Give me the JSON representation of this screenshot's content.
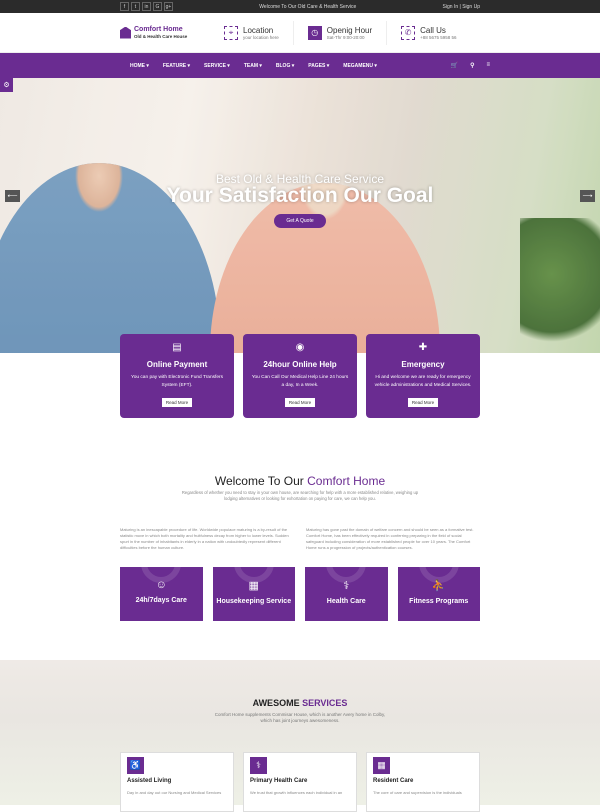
{
  "topbar": {
    "social": [
      "f",
      "t",
      "in",
      "G",
      "g+"
    ],
    "message": "Welcome To Our Old Care & Health Service",
    "signin": "Sign In",
    "signup": "Sign Up"
  },
  "header": {
    "logo_title": "Comfort Home",
    "logo_sub": "Old & Health Care House",
    "location": {
      "title": "Location",
      "sub": "your location here"
    },
    "hours": {
      "title": "Openig Hour",
      "sub": "Sat-Thr 9:00-20:00"
    },
    "call": {
      "title": "Call Us",
      "sub": "+88 5675 5958 56"
    }
  },
  "nav": {
    "items": [
      "HOME ▾",
      "FEATURE ▾",
      "SERVICE ▾",
      "TEAM ▾",
      "BLOG ▾",
      "PAGES ▾",
      "MEGAMENU ▾"
    ]
  },
  "hero": {
    "subtitle": "Best Old & Health Care Service",
    "title": "Your Satisfaction Our Goal",
    "button": "Get A Quote",
    "prev": "⟵",
    "next": "⟶"
  },
  "cards": [
    {
      "title": "Online Payment",
      "text": "You can pay with Electronic Fund Transfers System (EFT).",
      "button": "Read More"
    },
    {
      "title": "24hour Online Help",
      "text": "You Can Call Our Medical Help Line 24 hours a day, In a Week.",
      "button": "Read More"
    },
    {
      "title": "Emergency",
      "text": "Hi and welcome we are ready for emergency vehicle administrations and Medical Services.",
      "button": "Read More"
    }
  ],
  "welcome": {
    "title_a": "Welcome To Our ",
    "title_b": "Comfort Home",
    "sub": "Regardless of whether you need to stay in your own house, are searching for help with a more established relative, weighing up lodging alternatives or looking for exhortation on paying for care, we can help you.",
    "col1": "Maturing is an inescapable procedure of life. Worldwide populace maturing is a by-result of the statistic move in which both mortality and fruitfulness decay from higher to lower levels. Sudden spurt in the number of inhabitants in elderly in a nation with undoubtedly represent different difficulties before the human culture.",
    "col2": "Maturing has gone past the domain of welfare concern and should be seen as a formative test. Comfort Home, has been effectively required in conferring preparing in the field of social safeguard including consideration of more established people for over 10 years. The Comfort Home runs a progression of projects/authentication courses."
  },
  "services": [
    "24h/7days Care",
    "Housekeeping Service",
    "Health Care",
    "Fitness Programs"
  ],
  "awesome": {
    "title_a": "AWESOME ",
    "title_b": "SERVICES",
    "sub": "Comfort Home supplements Commisar House, which is another Avery home in Colby, which has joint journeys awesomeness.",
    "cards": [
      {
        "title": "Assisted Living",
        "text": "Day in and day out our Nursing and Medical Services"
      },
      {
        "title": "Primary Health Care",
        "text": "We trust that growth influences each individual in an"
      },
      {
        "title": "Resident Care",
        "text": "The core of care and supervision is the individuals"
      }
    ]
  }
}
